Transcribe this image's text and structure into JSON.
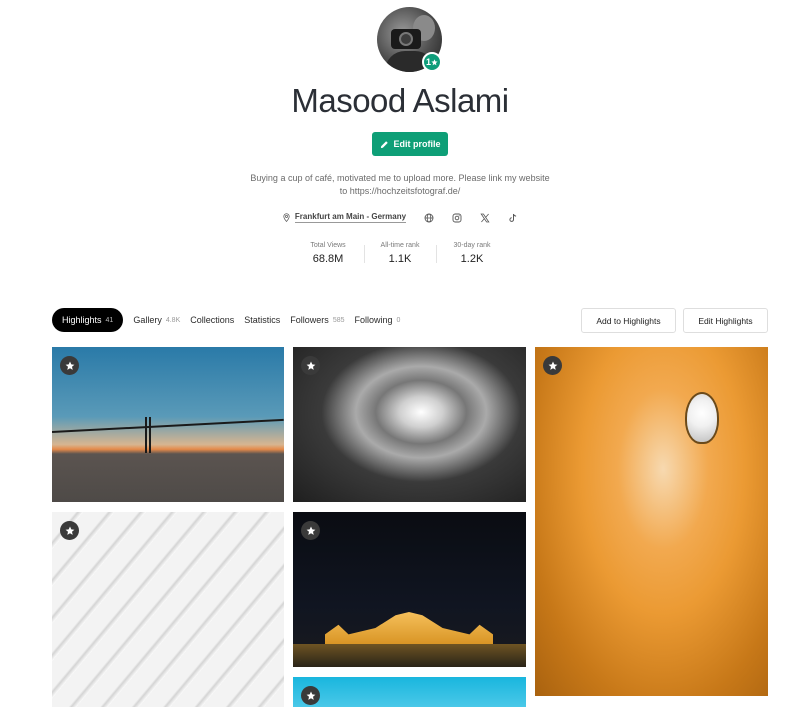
{
  "profile": {
    "name": "Masood Aslami",
    "avatar_badge": "1",
    "edit_label": "Edit profile",
    "bio": "Buying a cup of café, motivated me to upload more. Please link my website to https://hochzeitsfotograf.de/",
    "location": "Frankfurt am Main - Germany",
    "social_icons": [
      "globe-icon",
      "instagram-icon",
      "x-icon",
      "tiktok-icon"
    ]
  },
  "stats": [
    {
      "label": "Total Views",
      "value": "68.8M"
    },
    {
      "label": "All-time rank",
      "value": "1.1K"
    },
    {
      "label": "30-day rank",
      "value": "1.2K"
    }
  ],
  "tabs": [
    {
      "label": "Highlights",
      "count": "41",
      "active": true
    },
    {
      "label": "Gallery",
      "count": "4.8K"
    },
    {
      "label": "Collections",
      "count": ""
    },
    {
      "label": "Statistics",
      "count": ""
    },
    {
      "label": "Followers",
      "count": "585"
    },
    {
      "label": "Following",
      "count": "0"
    }
  ],
  "actions": {
    "add_highlights": "Add to Highlights",
    "edit_highlights": "Edit Highlights"
  },
  "colors": {
    "accent": "#0e9f77",
    "active_tab": "#000000"
  },
  "photos": [
    {
      "subject": "bridge-at-sunset"
    },
    {
      "subject": "spiral-staircase-bw"
    },
    {
      "subject": "spiral-staircase-lightbulb"
    },
    {
      "subject": "white-curved-lines"
    },
    {
      "subject": "parliament-at-night"
    },
    {
      "subject": "blue-sky"
    }
  ]
}
